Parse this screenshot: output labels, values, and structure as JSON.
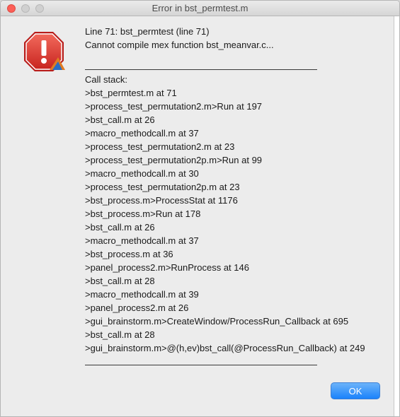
{
  "window": {
    "title": "Error in bst_permtest.m"
  },
  "message": {
    "line1": "Line 71:  bst_permtest (line 71)",
    "line2": "Cannot compile mex function bst_meanvar.c...",
    "call_stack_label": "Call stack:",
    "stack": [
      ">bst_permtest.m at 71",
      ">process_test_permutation2.m>Run at 197",
      ">bst_call.m at 26",
      ">macro_methodcall.m at 37",
      ">process_test_permutation2.m at 23",
      ">process_test_permutation2p.m>Run at 99",
      ">macro_methodcall.m at 30",
      ">process_test_permutation2p.m at 23",
      ">bst_process.m>ProcessStat at 1176",
      ">bst_process.m>Run at 178",
      ">bst_call.m at 26",
      ">macro_methodcall.m at 37",
      ">bst_process.m at 36",
      ">panel_process2.m>RunProcess at 146",
      ">bst_call.m at 28",
      ">macro_methodcall.m at 39",
      ">panel_process2.m at 26",
      ">gui_brainstorm.m>CreateWindow/ProcessRun_Callback at 695",
      ">bst_call.m at 28",
      ">gui_brainstorm.m>@(h,ev)bst_call(@ProcessRun_Callback) at 249"
    ]
  },
  "buttons": {
    "ok_label": "OK"
  },
  "icons": {
    "error": "error-stop-sign-icon"
  },
  "colors": {
    "ok_button": "#1a82fb",
    "error_icon": "#d62f2f",
    "close_light": "#fc5f57"
  }
}
